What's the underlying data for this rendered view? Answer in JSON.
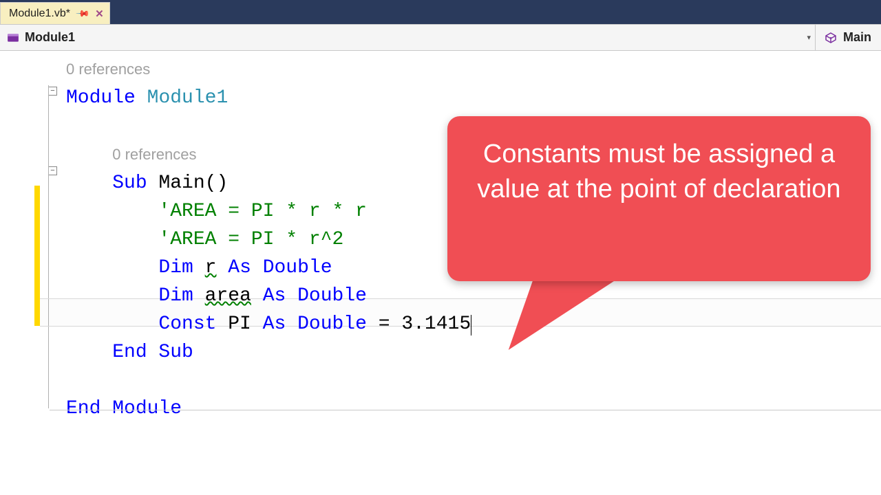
{
  "tab": {
    "title": "Module1.vb*"
  },
  "nav": {
    "left": "Module1",
    "right": "Main"
  },
  "refs": {
    "module": "0 references",
    "sub": "0 references"
  },
  "code": {
    "module_kw": "Module",
    "module_name": "Module1",
    "sub_kw": "Sub",
    "sub_name": "Main()",
    "c1": "'AREA = PI * r * r",
    "c2": "'AREA = PI * r^2",
    "dim_kw": "Dim",
    "as_kw": "As",
    "double_kw": "Double",
    "const_kw": "Const",
    "r_name": "r",
    "area_name": "area",
    "pi_name": "PI",
    "pi_assign": " = 3.1415",
    "end_sub": "End Sub",
    "end_module": "End Module"
  },
  "callout": {
    "text": "Constants must be assigned a value at the point of declaration"
  }
}
